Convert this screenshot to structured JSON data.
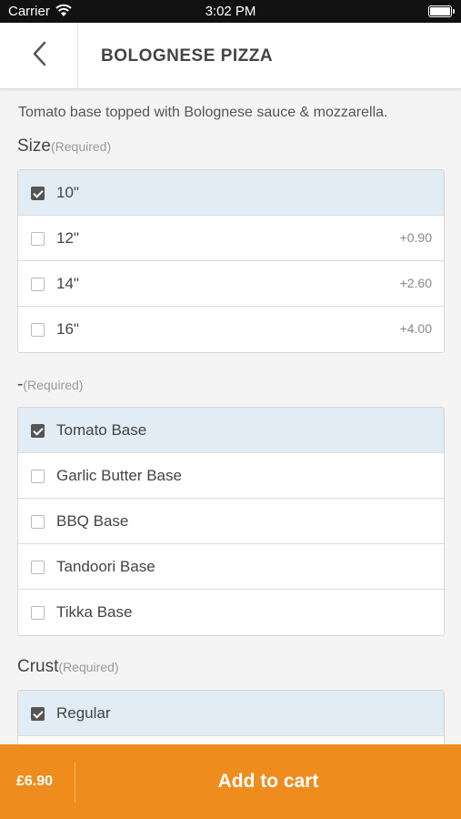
{
  "status_bar": {
    "carrier": "Carrier",
    "time": "3:02 PM"
  },
  "nav": {
    "title": "BOLOGNESE PIZZA"
  },
  "description": "Tomato base topped with Bolognese sauce & mozzarella.",
  "groups": [
    {
      "title": "Size",
      "required": "(Required)",
      "options": [
        {
          "label": "10\"",
          "price": "",
          "selected": true
        },
        {
          "label": "12\"",
          "price": "+0.90",
          "selected": false
        },
        {
          "label": "14\"",
          "price": "+2.60",
          "selected": false
        },
        {
          "label": "16\"",
          "price": "+4.00",
          "selected": false
        }
      ]
    },
    {
      "title": "-",
      "required": "(Required)",
      "options": [
        {
          "label": "Tomato Base",
          "price": "",
          "selected": true
        },
        {
          "label": "Garlic Butter Base",
          "price": "",
          "selected": false
        },
        {
          "label": "BBQ Base",
          "price": "",
          "selected": false
        },
        {
          "label": "Tandoori Base",
          "price": "",
          "selected": false
        },
        {
          "label": "Tikka Base",
          "price": "",
          "selected": false
        }
      ]
    },
    {
      "title": "Crust",
      "required": "(Required)",
      "options": [
        {
          "label": "Regular",
          "price": "",
          "selected": true
        },
        {
          "label": "",
          "price": "",
          "selected": false
        }
      ]
    }
  ],
  "cart": {
    "total": "£6.90",
    "add_label": "Add to cart"
  },
  "colors": {
    "accent": "#ef8c1e",
    "selected_row": "#e1ecf4"
  },
  "icons": {
    "back": "chevron-left-icon",
    "wifi": "wifi-icon",
    "battery": "battery-icon",
    "checkbox": "checkbox-icon"
  }
}
